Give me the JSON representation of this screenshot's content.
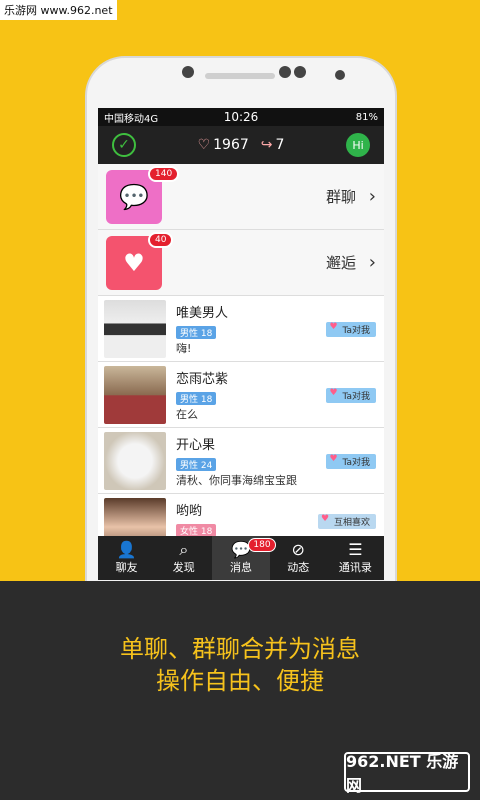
{
  "watermark": "乐游网 www.962.net",
  "status": {
    "carrier": "中国移动4G",
    "time": "10:26",
    "battery": "81%"
  },
  "topbar": {
    "hearts": "1967",
    "shares": "7",
    "hi": "Hi"
  },
  "specials": [
    {
      "label": "群聊",
      "badge": "140"
    },
    {
      "label": "邂逅",
      "badge": "40"
    }
  ],
  "chats": [
    {
      "name": "唯美男人",
      "gender": "男性",
      "age": "18",
      "message": "嗨!",
      "tag": "Ta对我"
    },
    {
      "name": "恋雨芯紫",
      "gender": "男性",
      "age": "18",
      "message": "在么",
      "tag": "Ta对我"
    },
    {
      "name": "开心果",
      "gender": "男性",
      "age": "24",
      "message": "清秋、你同事海绵宝宝跟",
      "tag": "Ta对我"
    },
    {
      "name": "哟哟",
      "gender": "女性",
      "age": "18",
      "message": "",
      "tag": "互相喜欢"
    }
  ],
  "tabs": [
    {
      "label": "聊友"
    },
    {
      "label": "发现"
    },
    {
      "label": "消息",
      "badge": "180"
    },
    {
      "label": "动态"
    },
    {
      "label": "通讯录"
    }
  ],
  "caption": {
    "line1": "单聊、群聊合并为消息",
    "line2": "操作自由、便捷"
  },
  "logo": "962.NET 乐游网"
}
